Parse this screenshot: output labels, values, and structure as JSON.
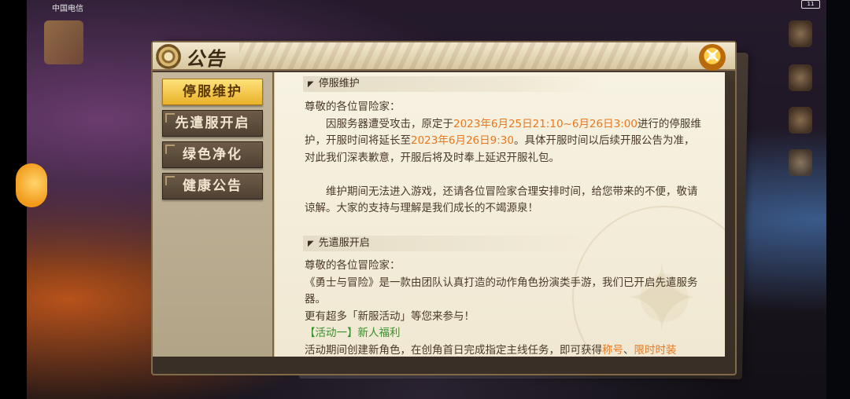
{
  "status_bar": {
    "carrier": "中国电信",
    "battery": "11"
  },
  "dialog": {
    "title": "公告",
    "close_icon": "close-x-icon",
    "nav": [
      {
        "label": "停服维护",
        "active": true
      },
      {
        "label": "先遣服开启",
        "active": false
      },
      {
        "label": "绿色净化",
        "active": false
      },
      {
        "label": "健康公告",
        "active": false
      }
    ],
    "sections": [
      {
        "heading": "停服维护",
        "greeting": "尊敬的各位冒险家：",
        "p1_a": "因服务器遭受攻击，原定于",
        "p1_time1": "2023年6月25日21:10~6月26日3:00",
        "p1_b": "进行的停服维护，开服时间将延长至",
        "p1_time2": "2023年6月26日9:30",
        "p1_c": "。具体开服时间以后续开服公告为准，对此我们深表歉意，开服后将及时奉上延迟开服礼包。",
        "p2": "维护期间无法进入游戏，还请各位冒险家合理安排时间，给您带来的不便，敬请谅解。大家的支持与理解是我们成长的不竭源泉！"
      },
      {
        "heading": "先遣服开启",
        "greeting": "尊敬的各位冒险家：",
        "p1": "《勇士与冒险》是一款由团队认真打造的动作角色扮演类手游，我们已开启先遣服务器。",
        "p2": "更有超多「新服活动」等您来参与！",
        "activity_title": "【活动一】新人福利",
        "activity_text_a": "活动期间创建新角色，在创角首日完成指定主线任务，即可获得",
        "activity_reward_1": "称号",
        "activity_sep": "、",
        "activity_reward_2": "限时时装"
      }
    ]
  },
  "colors": {
    "accent_orange": "#e9781e",
    "accent_green": "#3a8f2a",
    "nav_active": "#f0c040",
    "panel_brown": "#3a2f27"
  }
}
